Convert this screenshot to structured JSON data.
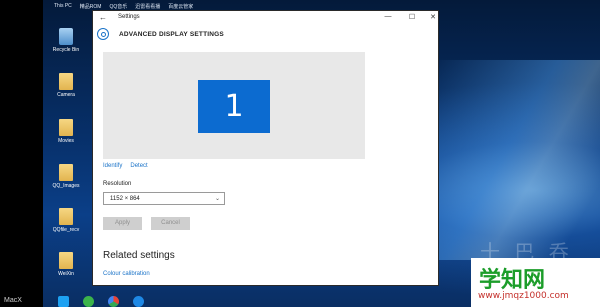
{
  "desktop": {
    "top_labels": [
      "This PC",
      "精品ROM",
      "QQ音乐",
      "迅雷看看播",
      "百度云管家"
    ],
    "icons": [
      {
        "label": "Recycle Bin",
        "icon": "recycle-bin-icon"
      },
      {
        "label": "Camera",
        "icon": "folder-icon"
      },
      {
        "label": "Movies",
        "icon": "folder-icon"
      },
      {
        "label": "QQ_Images",
        "icon": "folder-icon"
      },
      {
        "label": "QQfile_recv",
        "icon": "folder-icon"
      },
      {
        "label": "WeiXin",
        "icon": "folder-icon"
      }
    ],
    "corner_label": "MacX",
    "watermark": {
      "main": "学知网",
      "url": "www.jmqz1000.com"
    }
  },
  "window": {
    "title": "Settings",
    "back_glyph": "←",
    "controls": {
      "minimize": "—",
      "maximize": "☐",
      "close": "✕"
    }
  },
  "page": {
    "title": "ADVANCED DISPLAY SETTINGS",
    "monitor_number": "1",
    "links": {
      "identify": "Identify",
      "detect": "Detect"
    },
    "resolution": {
      "label": "Resolution",
      "value": "1152 × 864"
    },
    "buttons": {
      "apply": "Apply",
      "cancel": "Cancel"
    },
    "related_heading": "Related settings",
    "colour_link": "Colour calibration"
  },
  "colors": {
    "accent": "#0c6bd0",
    "link": "#1a73c8"
  }
}
